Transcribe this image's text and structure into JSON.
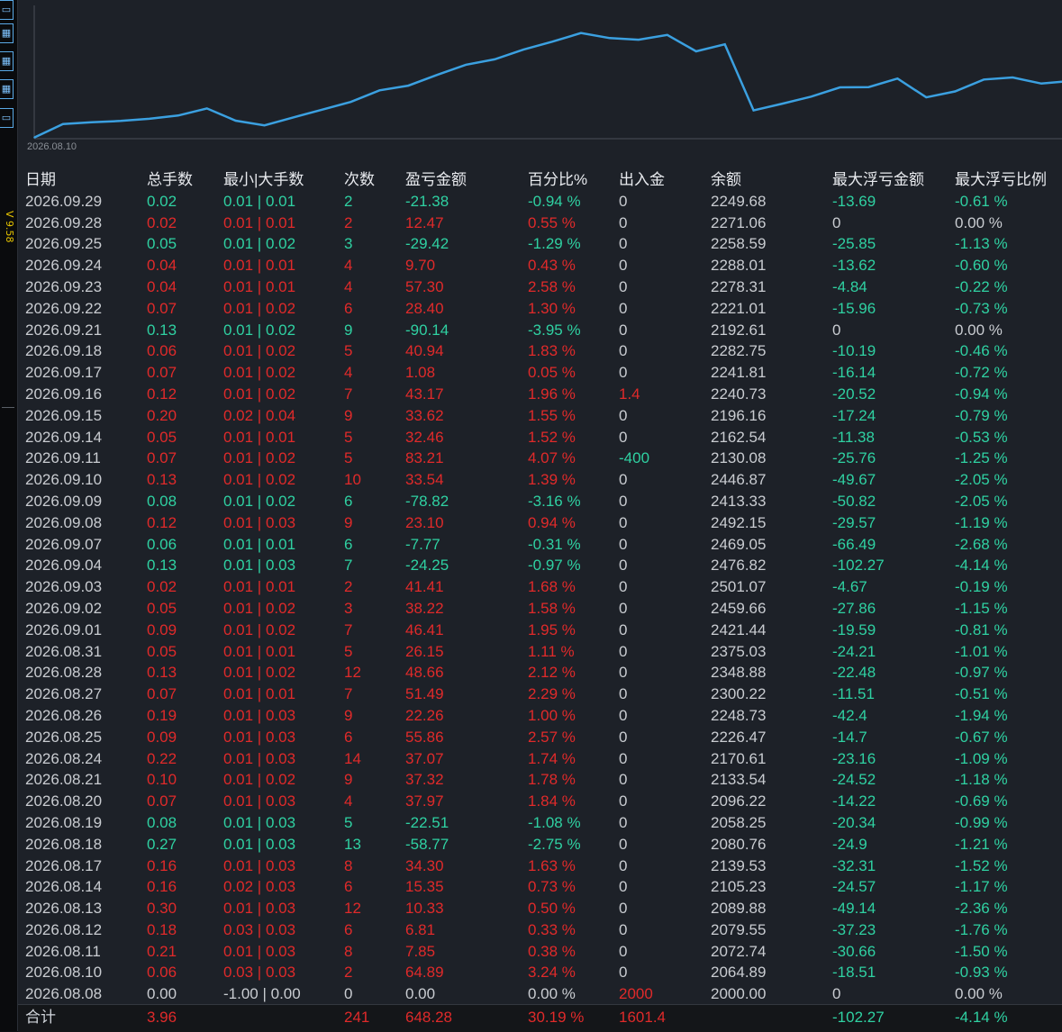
{
  "sidebar": {
    "icons": [
      {
        "name": "tool-icon-1",
        "glyph": "▭"
      },
      {
        "name": "tool-icon-2",
        "glyph": "▦"
      },
      {
        "name": "tool-icon-3",
        "glyph": "▦"
      },
      {
        "name": "tool-icon-4",
        "glyph": "▦"
      },
      {
        "name": "tool-icon-5",
        "glyph": "▭"
      }
    ],
    "version": "V 9.58"
  },
  "chart": {
    "x_start_label": "2026.08.10",
    "line_color": "#3ba0e0"
  },
  "chart_data": {
    "type": "line",
    "x": [
      "2026.08.08",
      "2026.08.10",
      "2026.08.11",
      "2026.08.12",
      "2026.08.13",
      "2026.08.14",
      "2026.08.17",
      "2026.08.18",
      "2026.08.19",
      "2026.08.20",
      "2026.08.21",
      "2026.08.24",
      "2026.08.25",
      "2026.08.26",
      "2026.08.27",
      "2026.08.28",
      "2026.08.31",
      "2026.09.01",
      "2026.09.02",
      "2026.09.03",
      "2026.09.04",
      "2026.09.07",
      "2026.09.08",
      "2026.09.09",
      "2026.09.10",
      "2026.09.11",
      "2026.09.14",
      "2026.09.15",
      "2026.09.16",
      "2026.09.17",
      "2026.09.18",
      "2026.09.21",
      "2026.09.22",
      "2026.09.23",
      "2026.09.24",
      "2026.09.25",
      "2026.09.28",
      "2026.09.29"
    ],
    "series": [
      {
        "values": [
          2000.0,
          2064.89,
          2072.74,
          2079.55,
          2089.88,
          2105.23,
          2139.53,
          2080.76,
          2058.25,
          2096.22,
          2133.54,
          2170.61,
          2226.47,
          2248.73,
          2300.22,
          2348.88,
          2375.03,
          2421.44,
          2459.66,
          2501.07,
          2476.82,
          2469.05,
          2492.15,
          2413.33,
          2446.87,
          2130.08,
          2162.54,
          2196.16,
          2240.73,
          2241.81,
          2282.75,
          2192.61,
          2221.01,
          2278.31,
          2288.01,
          2258.59,
          2271.06,
          2249.68
        ]
      }
    ]
  },
  "table": {
    "headers": {
      "date": "日期",
      "lots": "总手数",
      "minmax": "最小|大手数",
      "count": "次数",
      "pnl": "盈亏金额",
      "pct": "百分比%",
      "io": "出入金",
      "bal": "余额",
      "maxf": "最大浮亏金额",
      "maxp": "最大浮亏比例"
    },
    "rows": [
      {
        "d": "2026.09.29",
        "lots": "0.02",
        "mm": "0.01 | 0.01",
        "n": "2",
        "pnl": "-21.38",
        "pct": "-0.94 %",
        "io": "0",
        "bal": "2249.68",
        "mf": "-13.69",
        "mp": "-0.61 %",
        "t": "loss"
      },
      {
        "d": "2026.09.28",
        "lots": "0.02",
        "mm": "0.01 | 0.01",
        "n": "2",
        "pnl": "12.47",
        "pct": "0.55 %",
        "io": "0",
        "bal": "2271.06",
        "mf": "0",
        "mp": "0.00 %",
        "t": "win"
      },
      {
        "d": "2026.09.25",
        "lots": "0.05",
        "mm": "0.01 | 0.02",
        "n": "3",
        "pnl": "-29.42",
        "pct": "-1.29 %",
        "io": "0",
        "bal": "2258.59",
        "mf": "-25.85",
        "mp": "-1.13 %",
        "t": "loss"
      },
      {
        "d": "2026.09.24",
        "lots": "0.04",
        "mm": "0.01 | 0.01",
        "n": "4",
        "pnl": "9.70",
        "pct": "0.43 %",
        "io": "0",
        "bal": "2288.01",
        "mf": "-13.62",
        "mp": "-0.60 %",
        "t": "win"
      },
      {
        "d": "2026.09.23",
        "lots": "0.04",
        "mm": "0.01 | 0.01",
        "n": "4",
        "pnl": "57.30",
        "pct": "2.58 %",
        "io": "0",
        "bal": "2278.31",
        "mf": "-4.84",
        "mp": "-0.22 %",
        "t": "win"
      },
      {
        "d": "2026.09.22",
        "lots": "0.07",
        "mm": "0.01 | 0.02",
        "n": "6",
        "pnl": "28.40",
        "pct": "1.30 %",
        "io": "0",
        "bal": "2221.01",
        "mf": "-15.96",
        "mp": "-0.73 %",
        "t": "win"
      },
      {
        "d": "2026.09.21",
        "lots": "0.13",
        "mm": "0.01 | 0.02",
        "n": "9",
        "pnl": "-90.14",
        "pct": "-3.95 %",
        "io": "0",
        "bal": "2192.61",
        "mf": "0",
        "mp": "0.00 %",
        "t": "loss"
      },
      {
        "d": "2026.09.18",
        "lots": "0.06",
        "mm": "0.01 | 0.02",
        "n": "5",
        "pnl": "40.94",
        "pct": "1.83 %",
        "io": "0",
        "bal": "2282.75",
        "mf": "-10.19",
        "mp": "-0.46 %",
        "t": "win"
      },
      {
        "d": "2026.09.17",
        "lots": "0.07",
        "mm": "0.01 | 0.02",
        "n": "4",
        "pnl": "1.08",
        "pct": "0.05 %",
        "io": "0",
        "bal": "2241.81",
        "mf": "-16.14",
        "mp": "-0.72 %",
        "t": "win"
      },
      {
        "d": "2026.09.16",
        "lots": "0.12",
        "mm": "0.01 | 0.02",
        "n": "7",
        "pnl": "43.17",
        "pct": "1.96 %",
        "io": "1.4",
        "bal": "2240.73",
        "mf": "-20.52",
        "mp": "-0.94 %",
        "t": "win",
        "iot": "red"
      },
      {
        "d": "2026.09.15",
        "lots": "0.20",
        "mm": "0.02 | 0.04",
        "n": "9",
        "pnl": "33.62",
        "pct": "1.55 %",
        "io": "0",
        "bal": "2196.16",
        "mf": "-17.24",
        "mp": "-0.79 %",
        "t": "win"
      },
      {
        "d": "2026.09.14",
        "lots": "0.05",
        "mm": "0.01 | 0.01",
        "n": "5",
        "pnl": "32.46",
        "pct": "1.52 %",
        "io": "0",
        "bal": "2162.54",
        "mf": "-11.38",
        "mp": "-0.53 %",
        "t": "win"
      },
      {
        "d": "2026.09.11",
        "lots": "0.07",
        "mm": "0.01 | 0.02",
        "n": "5",
        "pnl": "83.21",
        "pct": "4.07 %",
        "io": "-400",
        "bal": "2130.08",
        "mf": "-25.76",
        "mp": "-1.25 %",
        "t": "win",
        "iot": "green"
      },
      {
        "d": "2026.09.10",
        "lots": "0.13",
        "mm": "0.01 | 0.02",
        "n": "10",
        "pnl": "33.54",
        "pct": "1.39 %",
        "io": "0",
        "bal": "2446.87",
        "mf": "-49.67",
        "mp": "-2.05 %",
        "t": "win"
      },
      {
        "d": "2026.09.09",
        "lots": "0.08",
        "mm": "0.01 | 0.02",
        "n": "6",
        "pnl": "-78.82",
        "pct": "-3.16 %",
        "io": "0",
        "bal": "2413.33",
        "mf": "-50.82",
        "mp": "-2.05 %",
        "t": "loss"
      },
      {
        "d": "2026.09.08",
        "lots": "0.12",
        "mm": "0.01 | 0.03",
        "n": "9",
        "pnl": "23.10",
        "pct": "0.94 %",
        "io": "0",
        "bal": "2492.15",
        "mf": "-29.57",
        "mp": "-1.19 %",
        "t": "win"
      },
      {
        "d": "2026.09.07",
        "lots": "0.06",
        "mm": "0.01 | 0.01",
        "n": "6",
        "pnl": "-7.77",
        "pct": "-0.31 %",
        "io": "0",
        "bal": "2469.05",
        "mf": "-66.49",
        "mp": "-2.68 %",
        "t": "loss"
      },
      {
        "d": "2026.09.04",
        "lots": "0.13",
        "mm": "0.01 | 0.03",
        "n": "7",
        "pnl": "-24.25",
        "pct": "-0.97 %",
        "io": "0",
        "bal": "2476.82",
        "mf": "-102.27",
        "mp": "-4.14 %",
        "t": "loss"
      },
      {
        "d": "2026.09.03",
        "lots": "0.02",
        "mm": "0.01 | 0.01",
        "n": "2",
        "pnl": "41.41",
        "pct": "1.68 %",
        "io": "0",
        "bal": "2501.07",
        "mf": "-4.67",
        "mp": "-0.19 %",
        "t": "win"
      },
      {
        "d": "2026.09.02",
        "lots": "0.05",
        "mm": "0.01 | 0.02",
        "n": "3",
        "pnl": "38.22",
        "pct": "1.58 %",
        "io": "0",
        "bal": "2459.66",
        "mf": "-27.86",
        "mp": "-1.15 %",
        "t": "win"
      },
      {
        "d": "2026.09.01",
        "lots": "0.09",
        "mm": "0.01 | 0.02",
        "n": "7",
        "pnl": "46.41",
        "pct": "1.95 %",
        "io": "0",
        "bal": "2421.44",
        "mf": "-19.59",
        "mp": "-0.81 %",
        "t": "win"
      },
      {
        "d": "2026.08.31",
        "lots": "0.05",
        "mm": "0.01 | 0.01",
        "n": "5",
        "pnl": "26.15",
        "pct": "1.11 %",
        "io": "0",
        "bal": "2375.03",
        "mf": "-24.21",
        "mp": "-1.01 %",
        "t": "win"
      },
      {
        "d": "2026.08.28",
        "lots": "0.13",
        "mm": "0.01 | 0.02",
        "n": "12",
        "pnl": "48.66",
        "pct": "2.12 %",
        "io": "0",
        "bal": "2348.88",
        "mf": "-22.48",
        "mp": "-0.97 %",
        "t": "win"
      },
      {
        "d": "2026.08.27",
        "lots": "0.07",
        "mm": "0.01 | 0.01",
        "n": "7",
        "pnl": "51.49",
        "pct": "2.29 %",
        "io": "0",
        "bal": "2300.22",
        "mf": "-11.51",
        "mp": "-0.51 %",
        "t": "win"
      },
      {
        "d": "2026.08.26",
        "lots": "0.19",
        "mm": "0.01 | 0.03",
        "n": "9",
        "pnl": "22.26",
        "pct": "1.00 %",
        "io": "0",
        "bal": "2248.73",
        "mf": "-42.4",
        "mp": "-1.94 %",
        "t": "win"
      },
      {
        "d": "2026.08.25",
        "lots": "0.09",
        "mm": "0.01 | 0.03",
        "n": "6",
        "pnl": "55.86",
        "pct": "2.57 %",
        "io": "0",
        "bal": "2226.47",
        "mf": "-14.7",
        "mp": "-0.67 %",
        "t": "win"
      },
      {
        "d": "2026.08.24",
        "lots": "0.22",
        "mm": "0.01 | 0.03",
        "n": "14",
        "pnl": "37.07",
        "pct": "1.74 %",
        "io": "0",
        "bal": "2170.61",
        "mf": "-23.16",
        "mp": "-1.09 %",
        "t": "win"
      },
      {
        "d": "2026.08.21",
        "lots": "0.10",
        "mm": "0.01 | 0.02",
        "n": "9",
        "pnl": "37.32",
        "pct": "1.78 %",
        "io": "0",
        "bal": "2133.54",
        "mf": "-24.52",
        "mp": "-1.18 %",
        "t": "win"
      },
      {
        "d": "2026.08.20",
        "lots": "0.07",
        "mm": "0.01 | 0.03",
        "n": "4",
        "pnl": "37.97",
        "pct": "1.84 %",
        "io": "0",
        "bal": "2096.22",
        "mf": "-14.22",
        "mp": "-0.69 %",
        "t": "win"
      },
      {
        "d": "2026.08.19",
        "lots": "0.08",
        "mm": "0.01 | 0.03",
        "n": "5",
        "pnl": "-22.51",
        "pct": "-1.08 %",
        "io": "0",
        "bal": "2058.25",
        "mf": "-20.34",
        "mp": "-0.99 %",
        "t": "loss"
      },
      {
        "d": "2026.08.18",
        "lots": "0.27",
        "mm": "0.01 | 0.03",
        "n": "13",
        "pnl": "-58.77",
        "pct": "-2.75 %",
        "io": "0",
        "bal": "2080.76",
        "mf": "-24.9",
        "mp": "-1.21 %",
        "t": "loss"
      },
      {
        "d": "2026.08.17",
        "lots": "0.16",
        "mm": "0.01 | 0.03",
        "n": "8",
        "pnl": "34.30",
        "pct": "1.63 %",
        "io": "0",
        "bal": "2139.53",
        "mf": "-32.31",
        "mp": "-1.52 %",
        "t": "win"
      },
      {
        "d": "2026.08.14",
        "lots": "0.16",
        "mm": "0.02 | 0.03",
        "n": "6",
        "pnl": "15.35",
        "pct": "0.73 %",
        "io": "0",
        "bal": "2105.23",
        "mf": "-24.57",
        "mp": "-1.17 %",
        "t": "win"
      },
      {
        "d": "2026.08.13",
        "lots": "0.30",
        "mm": "0.01 | 0.03",
        "n": "12",
        "pnl": "10.33",
        "pct": "0.50 %",
        "io": "0",
        "bal": "2089.88",
        "mf": "-49.14",
        "mp": "-2.36 %",
        "t": "win"
      },
      {
        "d": "2026.08.12",
        "lots": "0.18",
        "mm": "0.03 | 0.03",
        "n": "6",
        "pnl": "6.81",
        "pct": "0.33 %",
        "io": "0",
        "bal": "2079.55",
        "mf": "-37.23",
        "mp": "-1.76 %",
        "t": "win"
      },
      {
        "d": "2026.08.11",
        "lots": "0.21",
        "mm": "0.01 | 0.03",
        "n": "8",
        "pnl": "7.85",
        "pct": "0.38 %",
        "io": "0",
        "bal": "2072.74",
        "mf": "-30.66",
        "mp": "-1.50 %",
        "t": "win"
      },
      {
        "d": "2026.08.10",
        "lots": "0.06",
        "mm": "0.03 | 0.03",
        "n": "2",
        "pnl": "64.89",
        "pct": "3.24 %",
        "io": "0",
        "bal": "2064.89",
        "mf": "-18.51",
        "mp": "-0.93 %",
        "t": "win"
      },
      {
        "d": "2026.08.08",
        "lots": "0.00",
        "mm": "-1.00 | 0.00",
        "n": "0",
        "pnl": "0.00",
        "pct": "0.00 %",
        "io": "2000",
        "bal": "2000.00",
        "mf": "0",
        "mp": "0.00 %",
        "t": "flat",
        "iot": "red"
      }
    ],
    "summary": {
      "label": "合计",
      "lots": "3.96",
      "count": "241",
      "pnl": "648.28",
      "pct": "30.19 %",
      "io": "1601.4",
      "maxf": "-102.27",
      "maxp": "-4.14 %"
    }
  },
  "colors": {
    "profit": "#e02a2a",
    "loss": "#2fd1a2",
    "line": "#3ba0e0"
  }
}
